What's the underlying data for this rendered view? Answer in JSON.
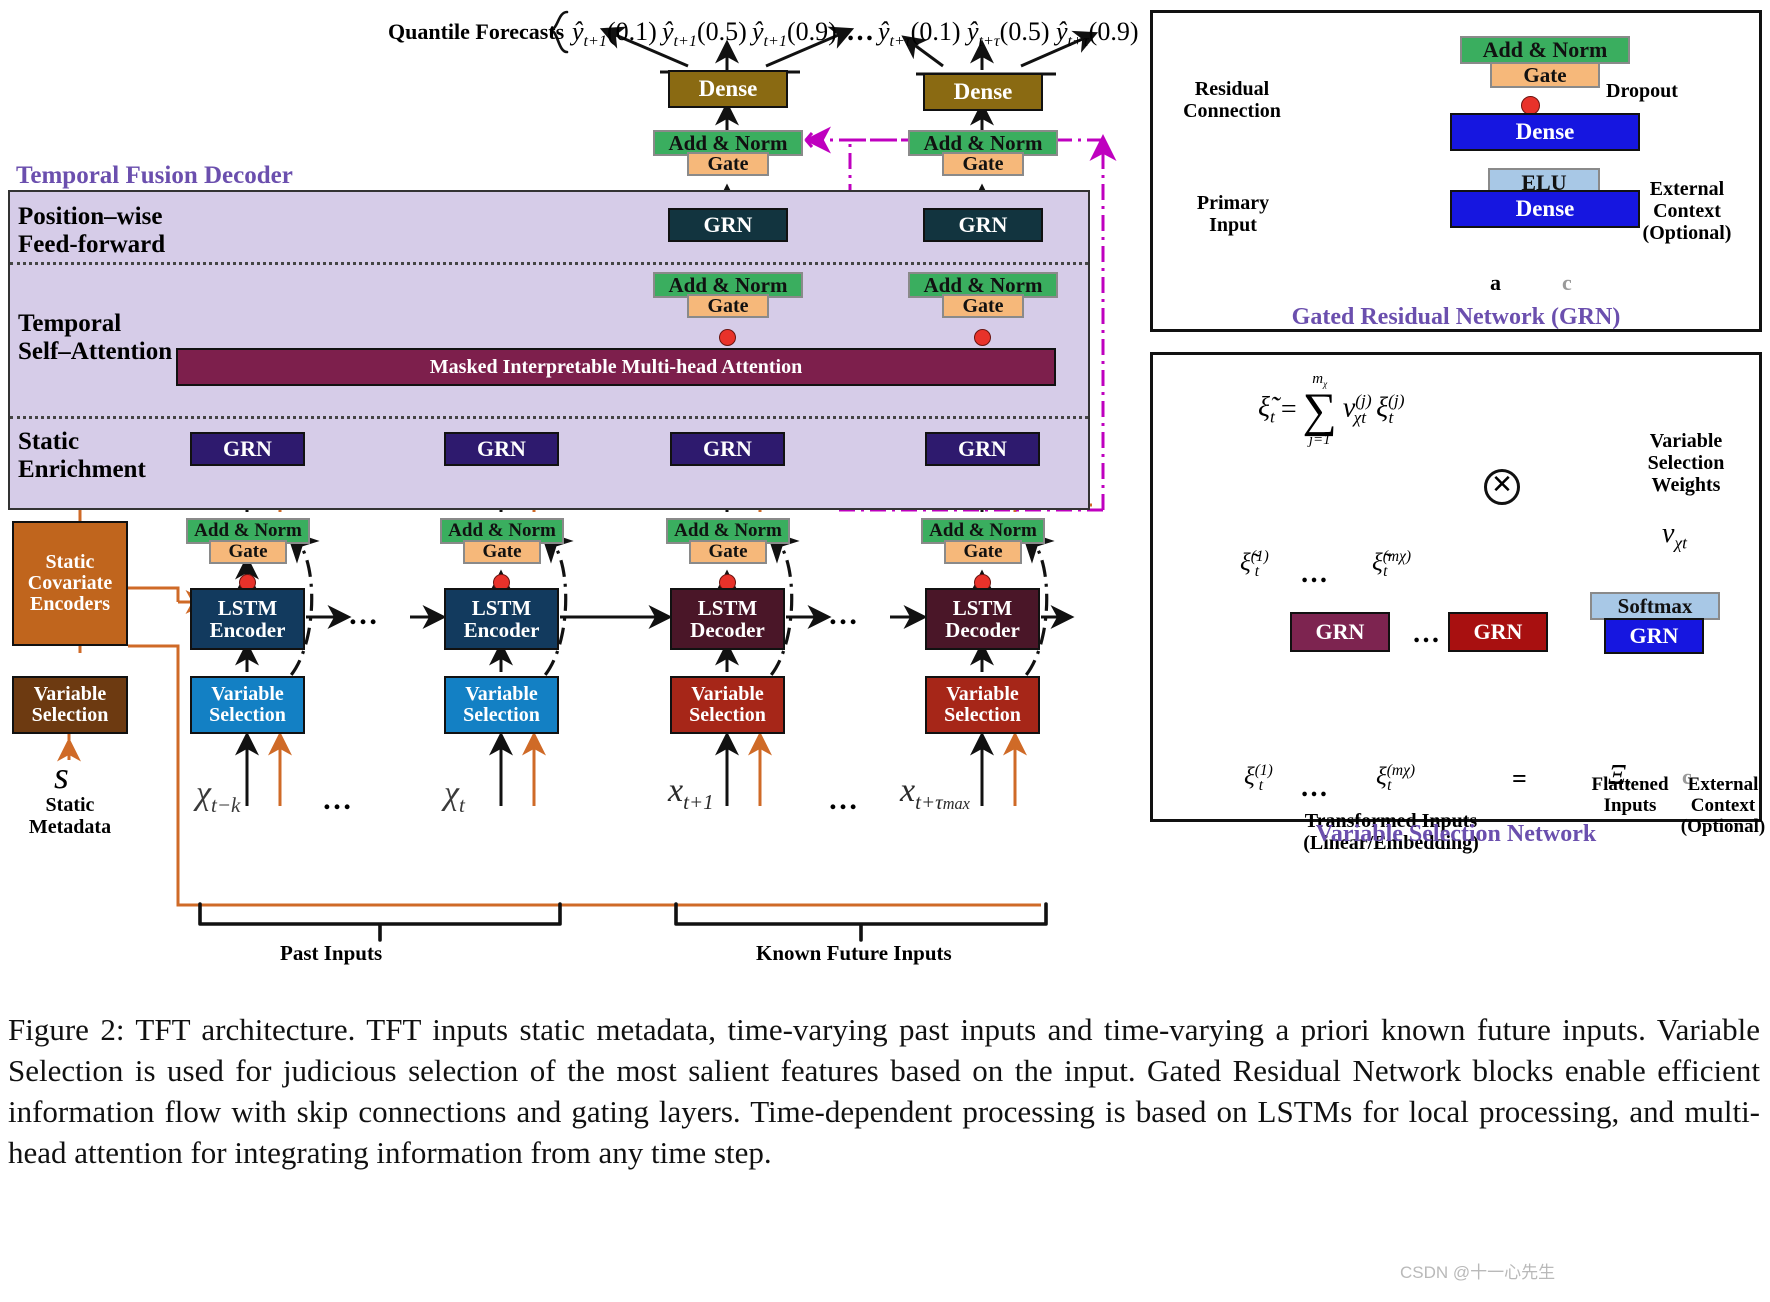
{
  "figure": {
    "caption": "Figure 2: TFT architecture. TFT inputs static metadata, time-varying past inputs and time-varying a priori known future inputs.  Variable Selection is used for judicious selection of the most salient features based on the input. Gated Residual Network blocks enable efficient information flow with skip connections and gating layers. Time-dependent processing is based on LSTMs for local processing, and multi-head attention for integrating information from any time step.",
    "watermark": "CSDN @十一心先生"
  },
  "colors": {
    "decoder_panel": "#d6cce8",
    "decoder_title": "#6b4fae",
    "add_norm": "#3aae5f",
    "gate": "#f6b87a",
    "dense_top": "#8a6a12",
    "grn_ff": "#12343f",
    "grn_static": "#2e1a6e",
    "attention": "#7d1f4c",
    "lstm_encoder": "#123a5e",
    "lstm_decoder": "#4a1628",
    "vs_past": "#1380c4",
    "vs_future": "#a62618",
    "static_encoder": "#c0651d",
    "static_vs": "#6d3a11",
    "dropout_dot": "#e8322a",
    "purple_feed": "#bf00bf",
    "orange_wire": "#cf6a27",
    "dense_blue": "#1616e0",
    "elu_blue": "#a8c8e6",
    "softmax_blue": "#a8c8e6",
    "grn_vsn_left": "#7d2450",
    "grn_vsn_right": "#a81010",
    "grn_vsn_blue": "#1616e0"
  },
  "quantiles": {
    "label": "Quantile Forecasts",
    "left": [
      "ŷ",
      "t+1"
    ],
    "items_left": [
      {
        "base": "ŷ",
        "sub": "t+1",
        "q": "(0.1)"
      },
      {
        "base": "ŷ",
        "sub": "t+1",
        "q": "(0.5)"
      },
      {
        "base": "ŷ",
        "sub": "t+1",
        "q": "(0.9)"
      }
    ],
    "ellipsis": "…",
    "items_right": [
      {
        "base": "ŷ",
        "sub": "t+τ",
        "q": "(0.1)"
      },
      {
        "base": "ŷ",
        "sub": "t+τ",
        "q": "(0.5)"
      },
      {
        "base": "ŷ",
        "sub": "t+τ",
        "q": "(0.9)"
      }
    ]
  },
  "decoder": {
    "title": "Temporal Fusion Decoder",
    "rows": [
      {
        "name": "Position-wise\nFeed-forward",
        "line1": "Position–wise",
        "line2": "Feed-forward"
      },
      {
        "name": "Temporal\nSelf-Attention",
        "line1": "Temporal",
        "line2": "Self–Attention"
      },
      {
        "name": "Static\nEnrichment",
        "line1": "Static",
        "line2": "Enrichment"
      }
    ],
    "attention_label": "Masked Interpretable Multi-head Attention"
  },
  "blocks": {
    "dense": "Dense",
    "add_norm": "Add & Norm",
    "gate": "Gate",
    "grn": "GRN",
    "lstm_encoder_l1": "LSTM",
    "lstm_encoder_l2": "Encoder",
    "lstm_decoder_l1": "LSTM",
    "lstm_decoder_l2": "Decoder",
    "variable_selection_l1": "Variable",
    "variable_selection_l2": "Selection",
    "static_covariate_encoders_l1": "Static",
    "static_covariate_encoders_l2": "Covariate",
    "static_covariate_encoders_l3": "Encoders"
  },
  "inputs": {
    "static_symbol": "s",
    "static_caption_l1": "Static",
    "static_caption_l2": "Metadata",
    "past_first": {
      "base": "χ",
      "sub": "t−k"
    },
    "past_last": {
      "base": "χ",
      "sub": "t"
    },
    "past_bracket": "Past Inputs",
    "future_first": {
      "base": "x",
      "sub": "t+1"
    },
    "future_last": {
      "base": "x",
      "sub": "t+τ",
      "sub2": "max"
    },
    "future_bracket": "Known Future Inputs",
    "ellipsis": "…"
  },
  "grn_panel": {
    "title": "Gated Residual Network (GRN)",
    "blocks": {
      "add_norm": "Add & Norm",
      "gate": "Gate",
      "dense_top": "Dense",
      "elu": "ELU",
      "dense_bottom": "Dense"
    },
    "annotations": {
      "residual_l1": "Residual",
      "residual_l2": "Connection",
      "primary_l1": "Primary",
      "primary_l2": "Input",
      "dropout": "Dropout",
      "external_l1": "External",
      "external_l2": "Context",
      "external_l3": "(Optional)"
    },
    "inputs": {
      "a": "a",
      "c": "c"
    }
  },
  "vsn_panel": {
    "title": "Variable Selection Network",
    "equation": {
      "lhs": "ξ̃",
      "lhs_sub": "t",
      "eq": "=",
      "sum": "∑",
      "sum_top": "m",
      "sum_top_sub": "χ",
      "sum_bottom": "j=1",
      "term1": "v",
      "term1_sub": "χt",
      "term1_sup": "(j)",
      "term2": "ξ",
      "term2_sub": "t",
      "term2_sup": "(j)"
    },
    "blocks": {
      "grn": "GRN",
      "softmax": "Softmax"
    },
    "symbols": {
      "xi_tilde_1": {
        "base": "ξ̃",
        "sup": "(1)",
        "sub": "t"
      },
      "xi_tilde_m": {
        "base": "ξ̃",
        "sup": "(mχ)",
        "sub": "t"
      },
      "xi_1": {
        "base": "ξ",
        "sup": "(1)",
        "sub": "t"
      },
      "xi_m": {
        "base": "ξ",
        "sup": "(mχ)",
        "sub": "t"
      },
      "v_chi_t": {
        "base": "v",
        "sub": "χt"
      },
      "Xi_t": {
        "base": "Ξ",
        "sub": "t"
      },
      "equals": "=",
      "c": "c",
      "ellipsis": "…",
      "times": "⊗"
    },
    "annotations": {
      "weights_l1": "Variable",
      "weights_l2": "Selection",
      "weights_l3": "Weights",
      "transformed_l1": "Transformed Inputs",
      "transformed_l2": "(Linear/Embedding)",
      "flattened_l1": "Flattened",
      "flattened_l2": "Inputs",
      "external_l1": "External",
      "external_l2": "Context",
      "external_l3": "(Optional)"
    }
  }
}
